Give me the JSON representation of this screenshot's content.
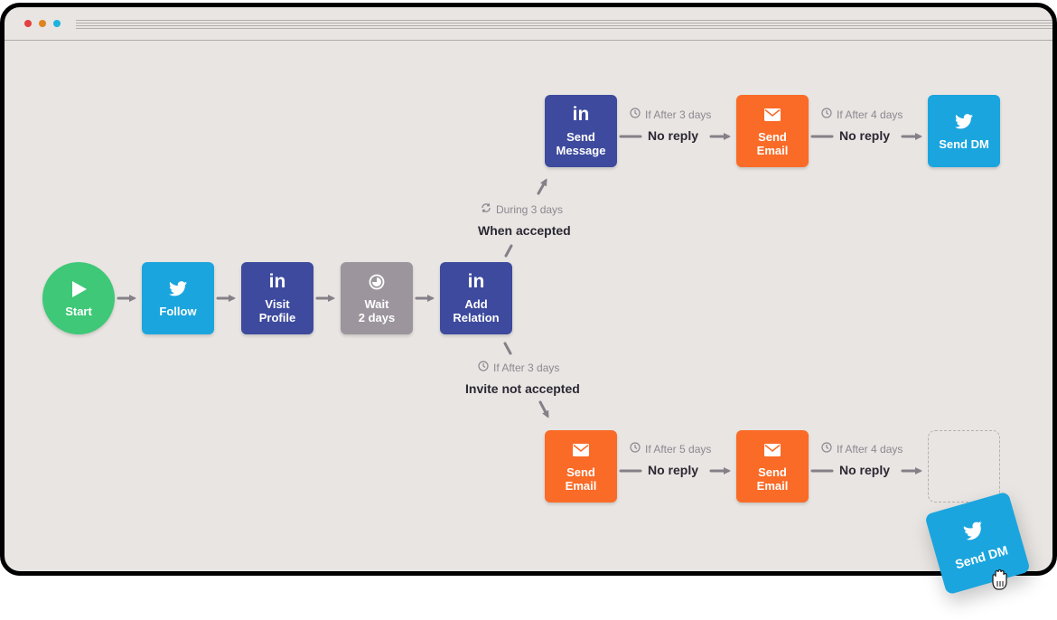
{
  "window": {
    "traffic_lights": [
      "close",
      "minimize",
      "maximize"
    ]
  },
  "colors": {
    "start": "#3ec877",
    "twitter": "#1aa5de",
    "linkedin": "#3d4a9e",
    "wait": "#9c959d",
    "email": "#fa6b27",
    "connector": "#857f88"
  },
  "nodes": {
    "start": {
      "label": "Start",
      "icon": "play-icon"
    },
    "follow": {
      "label": "Follow",
      "icon": "twitter-icon"
    },
    "visit_profile": {
      "label_line1": "Visit",
      "label_line2": "Profile",
      "icon": "linkedin-icon"
    },
    "wait": {
      "label_line1": "Wait",
      "label_line2": "2 days",
      "icon": "timer-icon"
    },
    "add_relation": {
      "label_line1": "Add",
      "label_line2": "Relation",
      "icon": "linkedin-icon"
    },
    "send_message": {
      "label_line1": "Send",
      "label_line2": "Message",
      "icon": "linkedin-icon"
    },
    "send_email_top": {
      "label_line1": "Send",
      "label_line2": "Email",
      "icon": "mail-icon"
    },
    "send_dm_top": {
      "label": "Send DM",
      "icon": "twitter-icon"
    },
    "send_email_bottom_1": {
      "label_line1": "Send",
      "label_line2": "Email",
      "icon": "mail-icon"
    },
    "send_email_bottom_2": {
      "label_line1": "Send",
      "label_line2": "Email",
      "icon": "mail-icon"
    },
    "dragged_send_dm": {
      "label": "Send DM",
      "icon": "twitter-icon"
    }
  },
  "conditions": {
    "when_accepted": {
      "timer": "During 3 days",
      "label": "When accepted"
    },
    "not_accepted": {
      "timer": "If After 3 days",
      "label": "Invite not accepted"
    },
    "top_1": {
      "timer": "If After 3 days",
      "label": "No reply"
    },
    "top_2": {
      "timer": "If After 4 days",
      "label": "No reply"
    },
    "bottom_1": {
      "timer": "If After 5 days",
      "label": "No reply"
    },
    "bottom_2": {
      "timer": "If After 4 days",
      "label": "No reply"
    }
  }
}
